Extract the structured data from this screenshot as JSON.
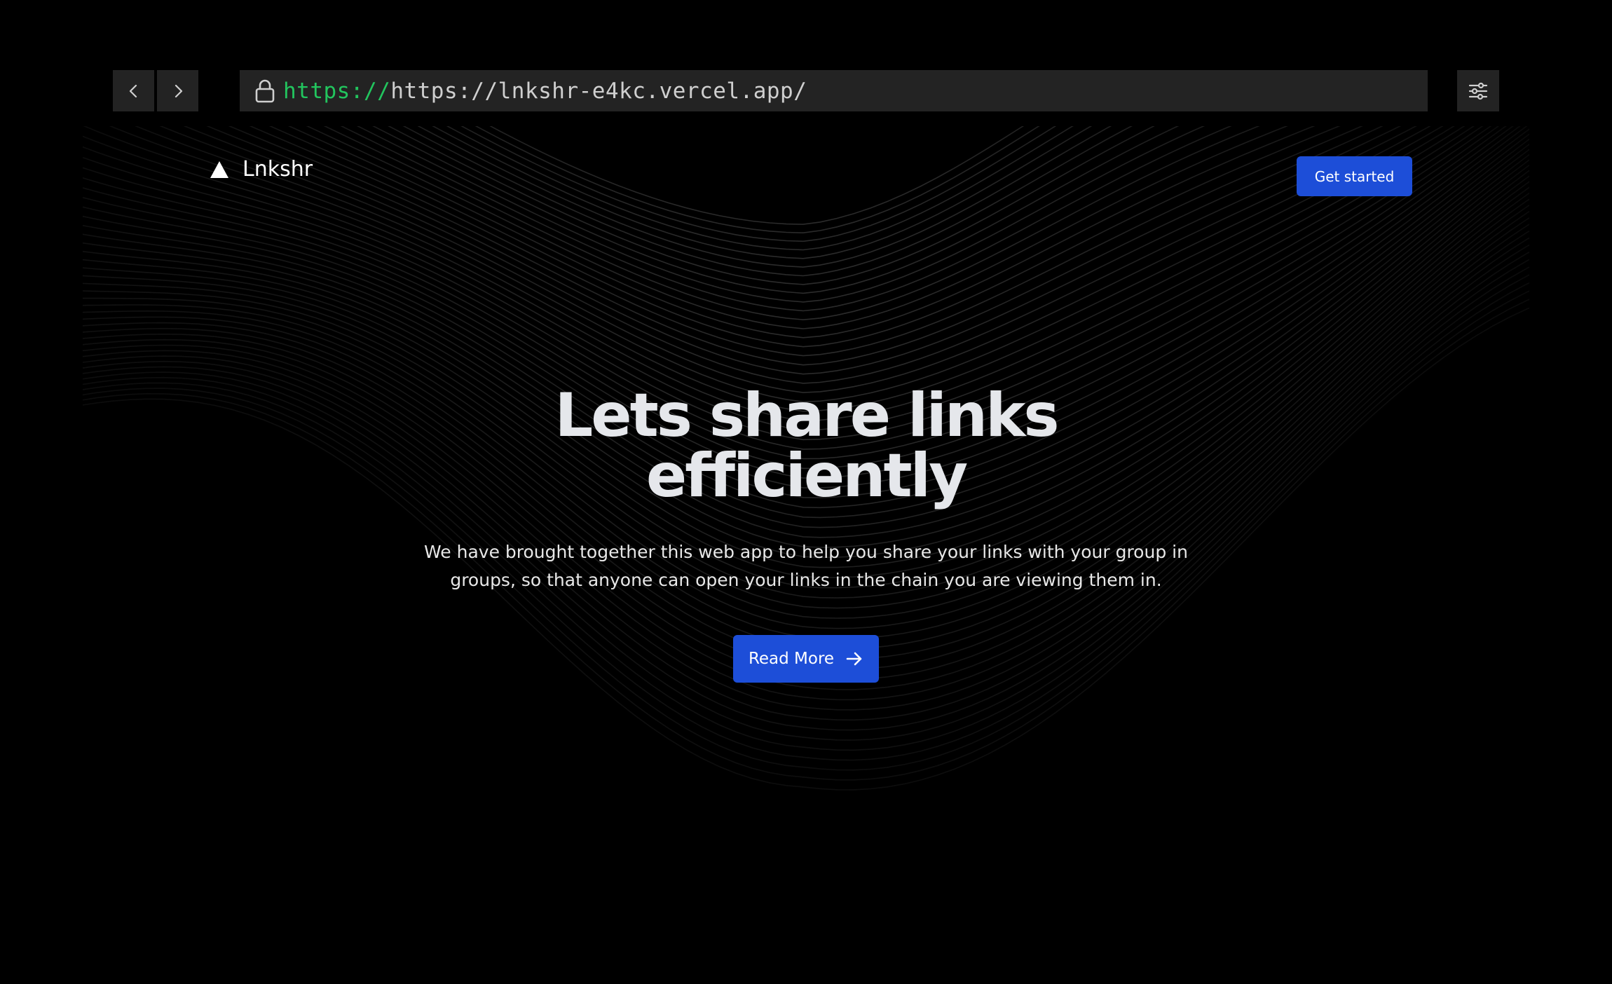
{
  "browser": {
    "url_scheme": "https://",
    "url_rest": "https://lnkshr-e4kc.vercel.app/",
    "icons": {
      "back": "chevron-left-icon",
      "forward": "chevron-right-icon",
      "lock": "lock-icon",
      "settings": "sliders-icon"
    }
  },
  "site": {
    "brand_name": "Lnkshr",
    "get_started_label": "Get started",
    "hero_title_line1": "Lets share links",
    "hero_title_line2": "efficiently",
    "hero_subtitle": "We have brought together this web app to help you share your links with your group in groups, so that anyone can open your links in the chain you are viewing them in.",
    "read_more_label": "Read More"
  },
  "colors": {
    "accent": "#1d4ed8",
    "url_scheme": "#22c55e",
    "background": "#000000",
    "chrome": "#232323"
  }
}
